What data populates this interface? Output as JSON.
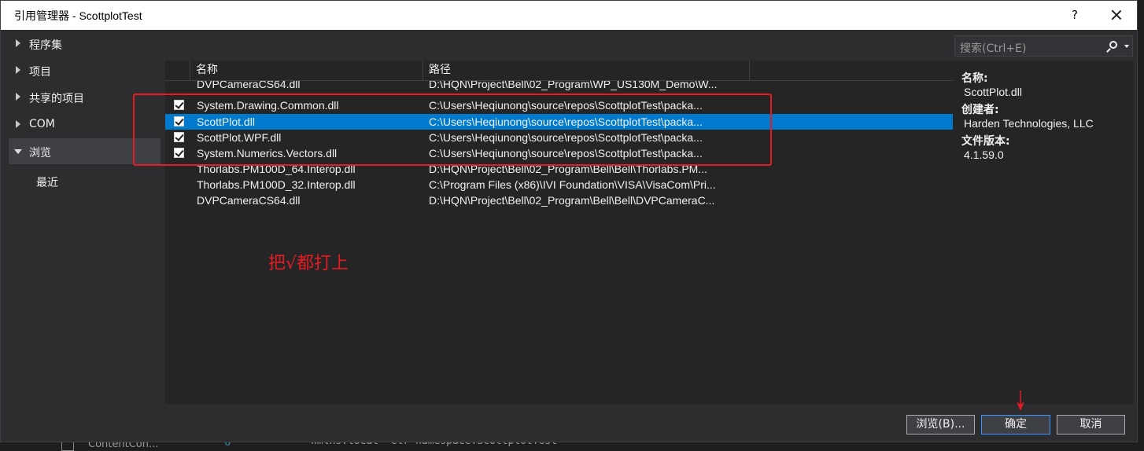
{
  "window": {
    "title": "引用管理器 - ScottplotTest",
    "help_label": "?"
  },
  "sidebar": {
    "items": [
      {
        "label": "程序集",
        "expanded": false
      },
      {
        "label": "项目",
        "expanded": false
      },
      {
        "label": "共享的项目",
        "expanded": false
      },
      {
        "label": "COM",
        "expanded": false
      },
      {
        "label": "浏览",
        "expanded": true,
        "selected": true
      }
    ],
    "sub_item": "最近"
  },
  "list": {
    "columns": [
      "名称",
      "路径"
    ],
    "partial_row": {
      "name": "DVPCameraCS64.dll",
      "path": "D:\\HQN\\Project\\Bell\\02_Program\\WP_US130M_Demo\\W..."
    },
    "rows": [
      {
        "name": "System.Drawing.Common.dll",
        "path": "C:\\Users\\Heqiunong\\source\\repos\\ScottplotTest\\packa...",
        "checked": true,
        "selected": false
      },
      {
        "name": "ScottPlot.dll",
        "path": "C:\\Users\\Heqiunong\\source\\repos\\ScottplotTest\\packa...",
        "checked": true,
        "selected": true
      },
      {
        "name": "ScottPlot.WPF.dll",
        "path": "C:\\Users\\Heqiunong\\source\\repos\\ScottplotTest\\packa...",
        "checked": true,
        "selected": false
      },
      {
        "name": "System.Numerics.Vectors.dll",
        "path": "C:\\Users\\Heqiunong\\source\\repos\\ScottplotTest\\packa...",
        "checked": true,
        "selected": false
      },
      {
        "name": "Thorlabs.PM100D_64.Interop.dll",
        "path": "D:\\HQN\\Project\\Bell\\02_Program\\Bell\\Bell\\Thorlabs.PM...",
        "checked": false,
        "selected": false
      },
      {
        "name": "Thorlabs.PM100D_32.Interop.dll",
        "path": "C:\\Program Files (x86)\\IVI Foundation\\VISA\\VisaCom\\Pri...",
        "checked": false,
        "selected": false
      },
      {
        "name": "DVPCameraCS64.dll",
        "path": "D:\\HQN\\Project\\Bell\\02_Program\\Bell\\Bell\\DVPCameraC...",
        "checked": false,
        "selected": false
      }
    ]
  },
  "annotation": "把√都打上",
  "search": {
    "placeholder": "搜索(Ctrl+E)"
  },
  "details": {
    "name_label": "名称:",
    "name_value": "ScottPlot.dll",
    "creator_label": "创建者:",
    "creator_value": "Harden Technologies, LLC",
    "version_label": "文件版本:",
    "version_value": "4.1.59.0"
  },
  "buttons": {
    "browse": "浏览(B)...",
    "ok": "确定",
    "cancel": "取消"
  },
  "background": {
    "line_number": "6",
    "code_text": "xmlns:local=\"clr-namespace:ScottplotTest\"",
    "tree_text": "ContentCon..."
  },
  "colors": {
    "selection": "#007acc",
    "annotation": "#e51c23",
    "dialog_bg": "#2d2d30",
    "list_bg": "#252526"
  }
}
